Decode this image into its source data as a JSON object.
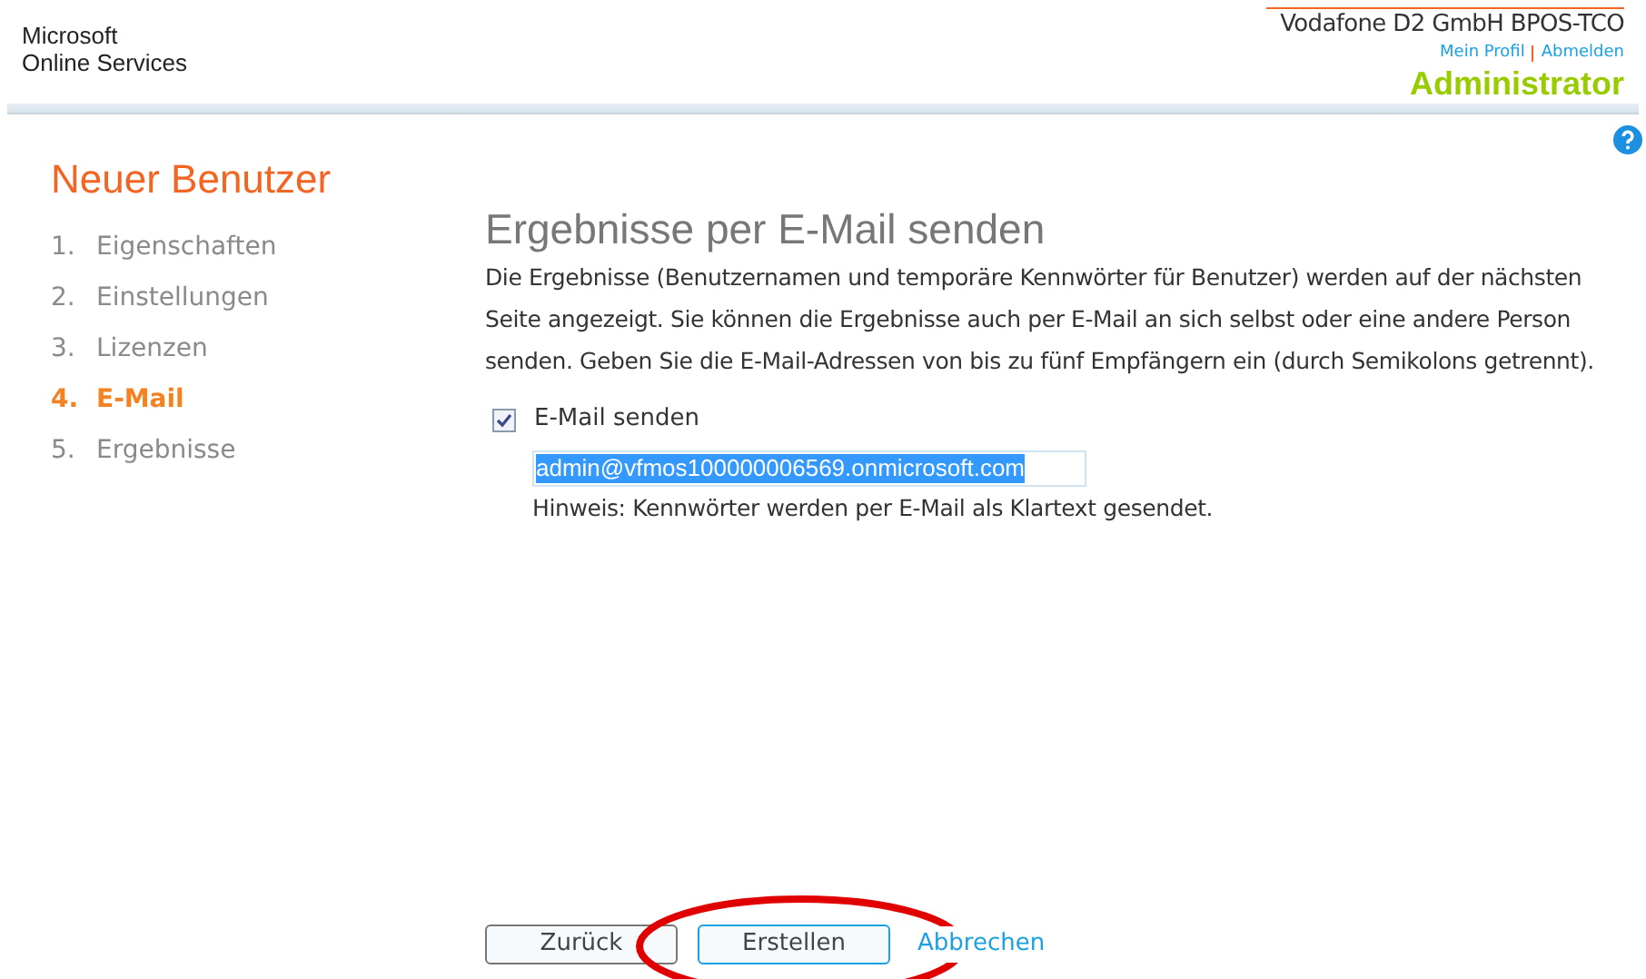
{
  "header": {
    "brand_line1": "Microsoft",
    "brand_line2": "Online Services",
    "company": "Vodafone D2 GmbH BPOS-TCO",
    "links": [
      "Mein Profil",
      "Abmelden"
    ],
    "role": "Administrator"
  },
  "wizard": {
    "title": "Neuer Benutzer",
    "steps": [
      {
        "number": "1.",
        "label": "Eigenschaften",
        "selected": false
      },
      {
        "number": "2.",
        "label": "Einstellungen",
        "selected": false
      },
      {
        "number": "3.",
        "label": "Lizenzen",
        "selected": false
      },
      {
        "number": "4.",
        "label": "E-Mail",
        "selected": true
      },
      {
        "number": "5.",
        "label": "Ergebnisse",
        "selected": false
      }
    ]
  },
  "main": {
    "title": "Ergebnisse per E-Mail senden",
    "description": "Die Ergebnisse (Benutzernamen und temporäre Kennwörter für Benutzer) werden auf der nächsten Seite angezeigt. Sie können die Ergebnisse auch per E-Mail an sich selbst oder eine andere Person senden. Geben Sie die E-Mail-Adressen von bis zu fünf Empfängern ein (durch Semikolons getrennt).",
    "send_email": {
      "label": "E-Mail senden",
      "checked": true
    },
    "email_field": {
      "value": "admin@vfmos100000006569.onmicrosoft.com"
    },
    "hint": "Hinweis: Kennwörter werden per E-Mail als Klartext gesendet."
  },
  "buttons": [
    {
      "kind": "button",
      "label": "Zurück",
      "focused": false
    },
    {
      "kind": "button",
      "label": "Erstellen",
      "focused": true
    },
    {
      "kind": "link",
      "label": "Abbrechen",
      "focused": false
    }
  ]
}
